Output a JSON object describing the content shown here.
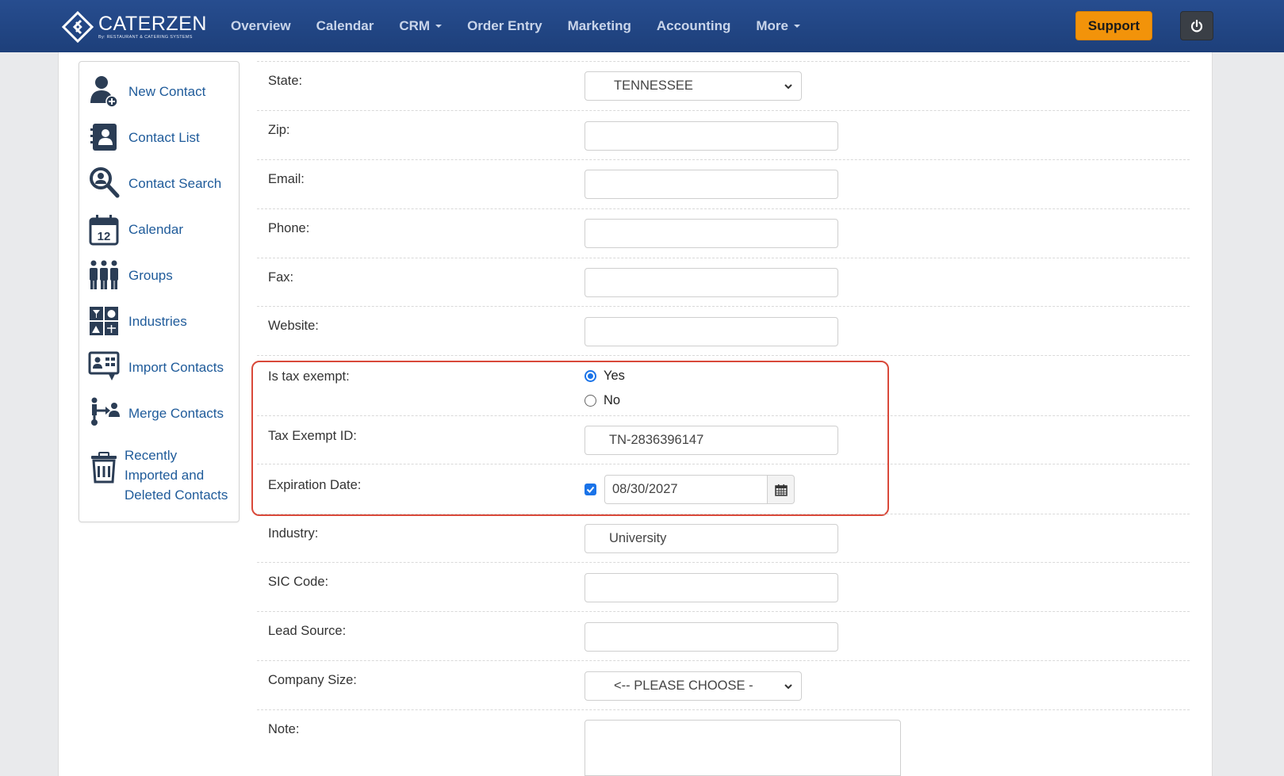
{
  "brand": {
    "name": "CATERZEN",
    "subtitle": "By: RESTAURANT & CATERING SYSTEMS"
  },
  "nav": {
    "items": [
      {
        "label": "Overview",
        "dropdown": false
      },
      {
        "label": "Calendar",
        "dropdown": false
      },
      {
        "label": "CRM",
        "dropdown": true
      },
      {
        "label": "Order Entry",
        "dropdown": false
      },
      {
        "label": "Marketing",
        "dropdown": false
      },
      {
        "label": "Accounting",
        "dropdown": false
      },
      {
        "label": "More",
        "dropdown": true
      }
    ],
    "support_label": "Support",
    "power_icon": "power-icon"
  },
  "sidebar": {
    "items": [
      {
        "label": "New Contact",
        "icon": "new-contact-icon"
      },
      {
        "label": "Contact List",
        "icon": "contact-list-icon"
      },
      {
        "label": "Contact Search",
        "icon": "contact-search-icon"
      },
      {
        "label": "Calendar",
        "icon": "calendar-icon"
      },
      {
        "label": "Groups",
        "icon": "groups-icon"
      },
      {
        "label": "Industries",
        "icon": "industries-icon"
      },
      {
        "label": "Import Contacts",
        "icon": "import-contacts-icon"
      },
      {
        "label": "Merge Contacts",
        "icon": "merge-contacts-icon"
      },
      {
        "label": "Recently Imported and Deleted Contacts",
        "lines": [
          "Recently",
          "Imported and",
          "Deleted Contacts"
        ],
        "icon": "trash-icon"
      }
    ]
  },
  "form": {
    "state": {
      "label": "State:",
      "value": "TENNESSEE"
    },
    "zip": {
      "label": "Zip:",
      "value": ""
    },
    "email": {
      "label": "Email:",
      "value": ""
    },
    "phone": {
      "label": "Phone:",
      "value": ""
    },
    "fax": {
      "label": "Fax:",
      "value": ""
    },
    "website": {
      "label": "Website:",
      "value": ""
    },
    "tax_exempt": {
      "label": "Is tax exempt:",
      "options": [
        "Yes",
        "No"
      ],
      "selected": "Yes"
    },
    "tax_exempt_id": {
      "label": "Tax Exempt ID:",
      "value": "TN-2836396147"
    },
    "expiration_date": {
      "label": "Expiration Date:",
      "enabled": true,
      "value": "08/30/2027"
    },
    "industry": {
      "label": "Industry:",
      "value": "University"
    },
    "sic_code": {
      "label": "SIC Code:",
      "value": ""
    },
    "lead_source": {
      "label": "Lead Source:",
      "value": ""
    },
    "company_size": {
      "label": "Company Size:",
      "value": "<-- PLEASE CHOOSE -"
    },
    "note": {
      "label": "Note:",
      "value": ""
    }
  },
  "colors": {
    "navbar": "#1d3f7a",
    "support": "#f2930a",
    "link": "#1f5b9a",
    "highlight": "#d9493a",
    "accent": "#1a73e8"
  }
}
